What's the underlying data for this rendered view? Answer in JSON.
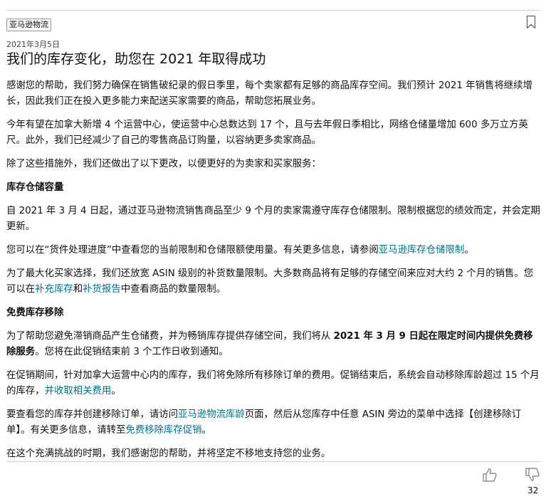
{
  "post": {
    "tag": "亚马逊物流",
    "date": "2021年3月5日",
    "title": "我们的库存变化，助您在 2021 年取得成功"
  },
  "body": {
    "p1": "感谢您的帮助，我们努力确保在销售破纪录的假日季里，每个卖家都有足够的商品库存空间。我们预计 2021 年销售将继续增长，因此我们正在投入更多能力来配送买家需要的商品，帮助您拓展业务。",
    "p2": "今年有望在加拿大新增 4 个运营中心，使运营中心总数达到 17 个，且与去年假日季相比，网络仓储量增加 600 多万立方英尺。此外，我们已经减少了自己的零售商品订购量，以容纳更多卖家商品。",
    "p3": "除了这些措施外，我们还做出了以下更改，以便更好的为卖家和买家服务：",
    "h1": "库存仓储容量",
    "p4": "自 2021 年 3 月 4 日起，通过亚马逊物流销售商品至少 9 个月的卖家需遵守库存仓储限制。限制根据您的绩效而定，并会定期更新。",
    "p5_a": "您可以在“货件处理进度”中查看您的当前限制和仓储限额使用量。有关更多信息，请参阅",
    "p5_link": "亚马逊库存仓储限制",
    "p5_b": "。",
    "p6_a": "为了最大化买家选择，我们还放宽 ASIN 级别的补货数量限制。大多数商品将有足够的存储空间来应对大约 2 个月的销售。您可以在",
    "p6_link1": "补充库存",
    "p6_mid": "和",
    "p6_link2": "补货报告",
    "p6_b": "中查看商品的数量限制。",
    "h2": "免费库存移除",
    "p7_a": "为了帮助您避免滞销商品产生仓储费，并为畅销库存提供存储空间，我们将从 ",
    "p7_bold": "2021 年 3 月 9 日起在限定时间内提供免费移除服务",
    "p7_b": "。您将在此促销结束前 3 个工作日收到通知。",
    "p8_a": "在促销期间，针对加拿大运营中心内的库存，我们将免除所有移除订单的费用。促销结束后，系统会自动移除库龄超过 15 个月的库存，",
    "p8_link": "并收取相关费用",
    "p8_b": "。",
    "p9_a": "要查看您的库存并创建移除订单，请访问",
    "p9_link1": "亚马逊物流库龄",
    "p9_mid": "页面，然后从您库存中任意 ASIN 旁边的菜单中选择【创建移除订单】。有关更多信息，请转至",
    "p9_link2": "免费移除库存促销",
    "p9_b": "。",
    "p10": "在这个充满挑战的时期，我们感谢您的帮助，并将坚定不移地支持您的业务。"
  },
  "feedback": {
    "count": "32",
    "up_icon": "thumbs-up-icon",
    "down_icon": "thumbs-down-icon"
  },
  "colors": {
    "link": "#007185",
    "text": "#111111",
    "rule": "#cfcfcf"
  }
}
